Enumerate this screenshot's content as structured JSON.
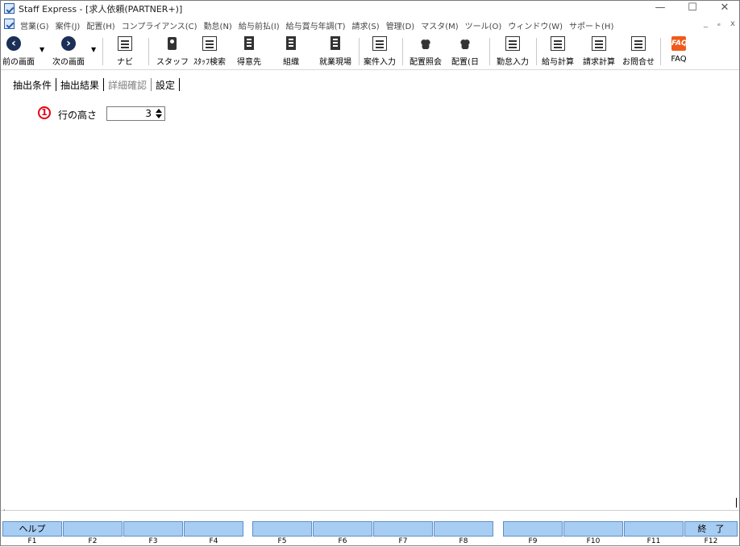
{
  "window": {
    "title": "Staff Express - [求人依頼(PARTNER+)]",
    "controls": [
      "—",
      "☐",
      "✕"
    ],
    "mdi_controls": [
      "_",
      "ₑ",
      "x"
    ]
  },
  "menu": [
    "営業(G)",
    "案件(J)",
    "配置(H)",
    "コンプライアンス(C)",
    "勤怠(N)",
    "給与前払(I)",
    "給与賞与年調(T)",
    "請求(S)",
    "管理(D)",
    "マスタ(M)",
    "ツール(O)",
    "ウィンドウ(W)",
    "サポート(H)"
  ],
  "toolbar": {
    "prev": "前の画面",
    "next": "次の画面",
    "navi": "ナビ",
    "staff": "スタッフ",
    "staff_search": "ｽﾀｯﾌ検索",
    "customer": "得意先",
    "org": "組織",
    "worksite": "就業現場",
    "job_input": "案件入力",
    "placement_inquiry": "配置照会",
    "placement_daily": "配置(日",
    "attendance_input": "勤怠入力",
    "payroll_calc": "給与計算",
    "billing_calc": "請求計算",
    "inquiry": "お問合せ",
    "faq": "FAQ",
    "faq_icon_text": "FAQ"
  },
  "tabs": [
    {
      "label": "抽出条件",
      "disabled": false
    },
    {
      "label": "抽出結果",
      "disabled": false
    },
    {
      "label": "詳細確認",
      "disabled": true
    },
    {
      "label": "設定",
      "disabled": false
    }
  ],
  "settings": {
    "badge": "1",
    "row_height_label": "行の高さ",
    "row_height_value": "3"
  },
  "fkeys": [
    {
      "key": "F1",
      "label": "ヘルプ"
    },
    {
      "key": "F2",
      "label": ""
    },
    {
      "key": "F3",
      "label": ""
    },
    {
      "key": "F4",
      "label": ""
    },
    {
      "key": "F5",
      "label": ""
    },
    {
      "key": "F6",
      "label": ""
    },
    {
      "key": "F7",
      "label": ""
    },
    {
      "key": "F8",
      "label": ""
    },
    {
      "key": "F9",
      "label": ""
    },
    {
      "key": "F10",
      "label": ""
    },
    {
      "key": "F11",
      "label": ""
    },
    {
      "key": "F12",
      "label": "終　了"
    }
  ],
  "colors": {
    "fkey_bg": "#a8cdf2",
    "badge_red": "#e60012",
    "faq_orange": "#f05a1a",
    "nav_dark": "#1b2f57"
  }
}
